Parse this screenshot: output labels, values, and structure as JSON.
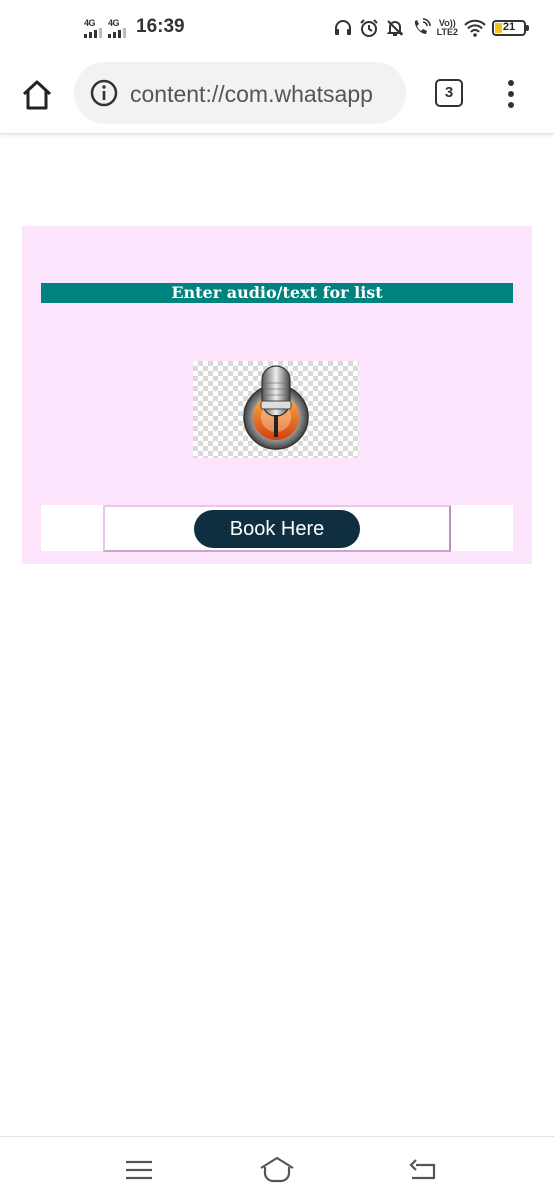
{
  "status_bar": {
    "sim1_label": "4G",
    "sim2_label": "4G",
    "time": "16:39",
    "volte_top": "Vo))",
    "volte_bottom": "LTE2",
    "battery_level": "21"
  },
  "browser": {
    "url": "content://com.whatsapp",
    "tab_count": "3"
  },
  "page": {
    "heading": "Enter audio/text for list",
    "book_button_label": "Book Here",
    "colors": {
      "panel_bg": "#fde4fd",
      "heading_bg": "#00827f",
      "button_bg": "#0f2e3f"
    }
  }
}
